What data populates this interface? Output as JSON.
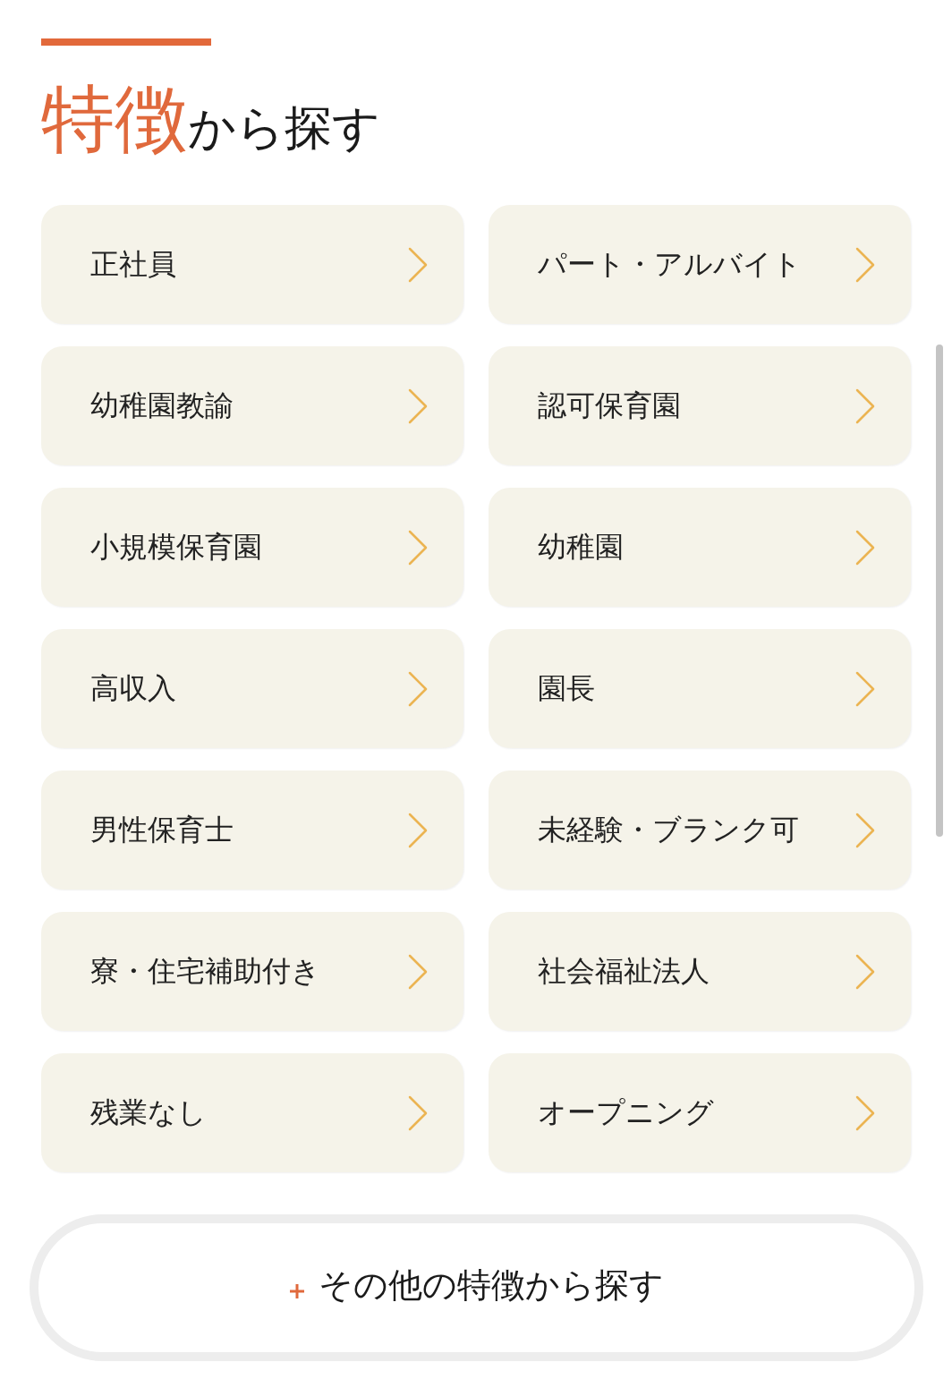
{
  "heading": {
    "emphasis": "特徴",
    "text": "から探す"
  },
  "features": [
    {
      "label": "正社員"
    },
    {
      "label": "パート・アルバイト"
    },
    {
      "label": "幼稚園教諭"
    },
    {
      "label": "認可保育園"
    },
    {
      "label": "小規模保育園"
    },
    {
      "label": "幼稚園"
    },
    {
      "label": "高収入"
    },
    {
      "label": "園長"
    },
    {
      "label": "男性保育士"
    },
    {
      "label": "未経験・ブランク可"
    },
    {
      "label": "寮・住宅補助付き"
    },
    {
      "label": "社会福祉法人"
    },
    {
      "label": "残業なし"
    },
    {
      "label": "オープニング"
    }
  ],
  "more_button": {
    "label": "その他の特徴から探す"
  }
}
